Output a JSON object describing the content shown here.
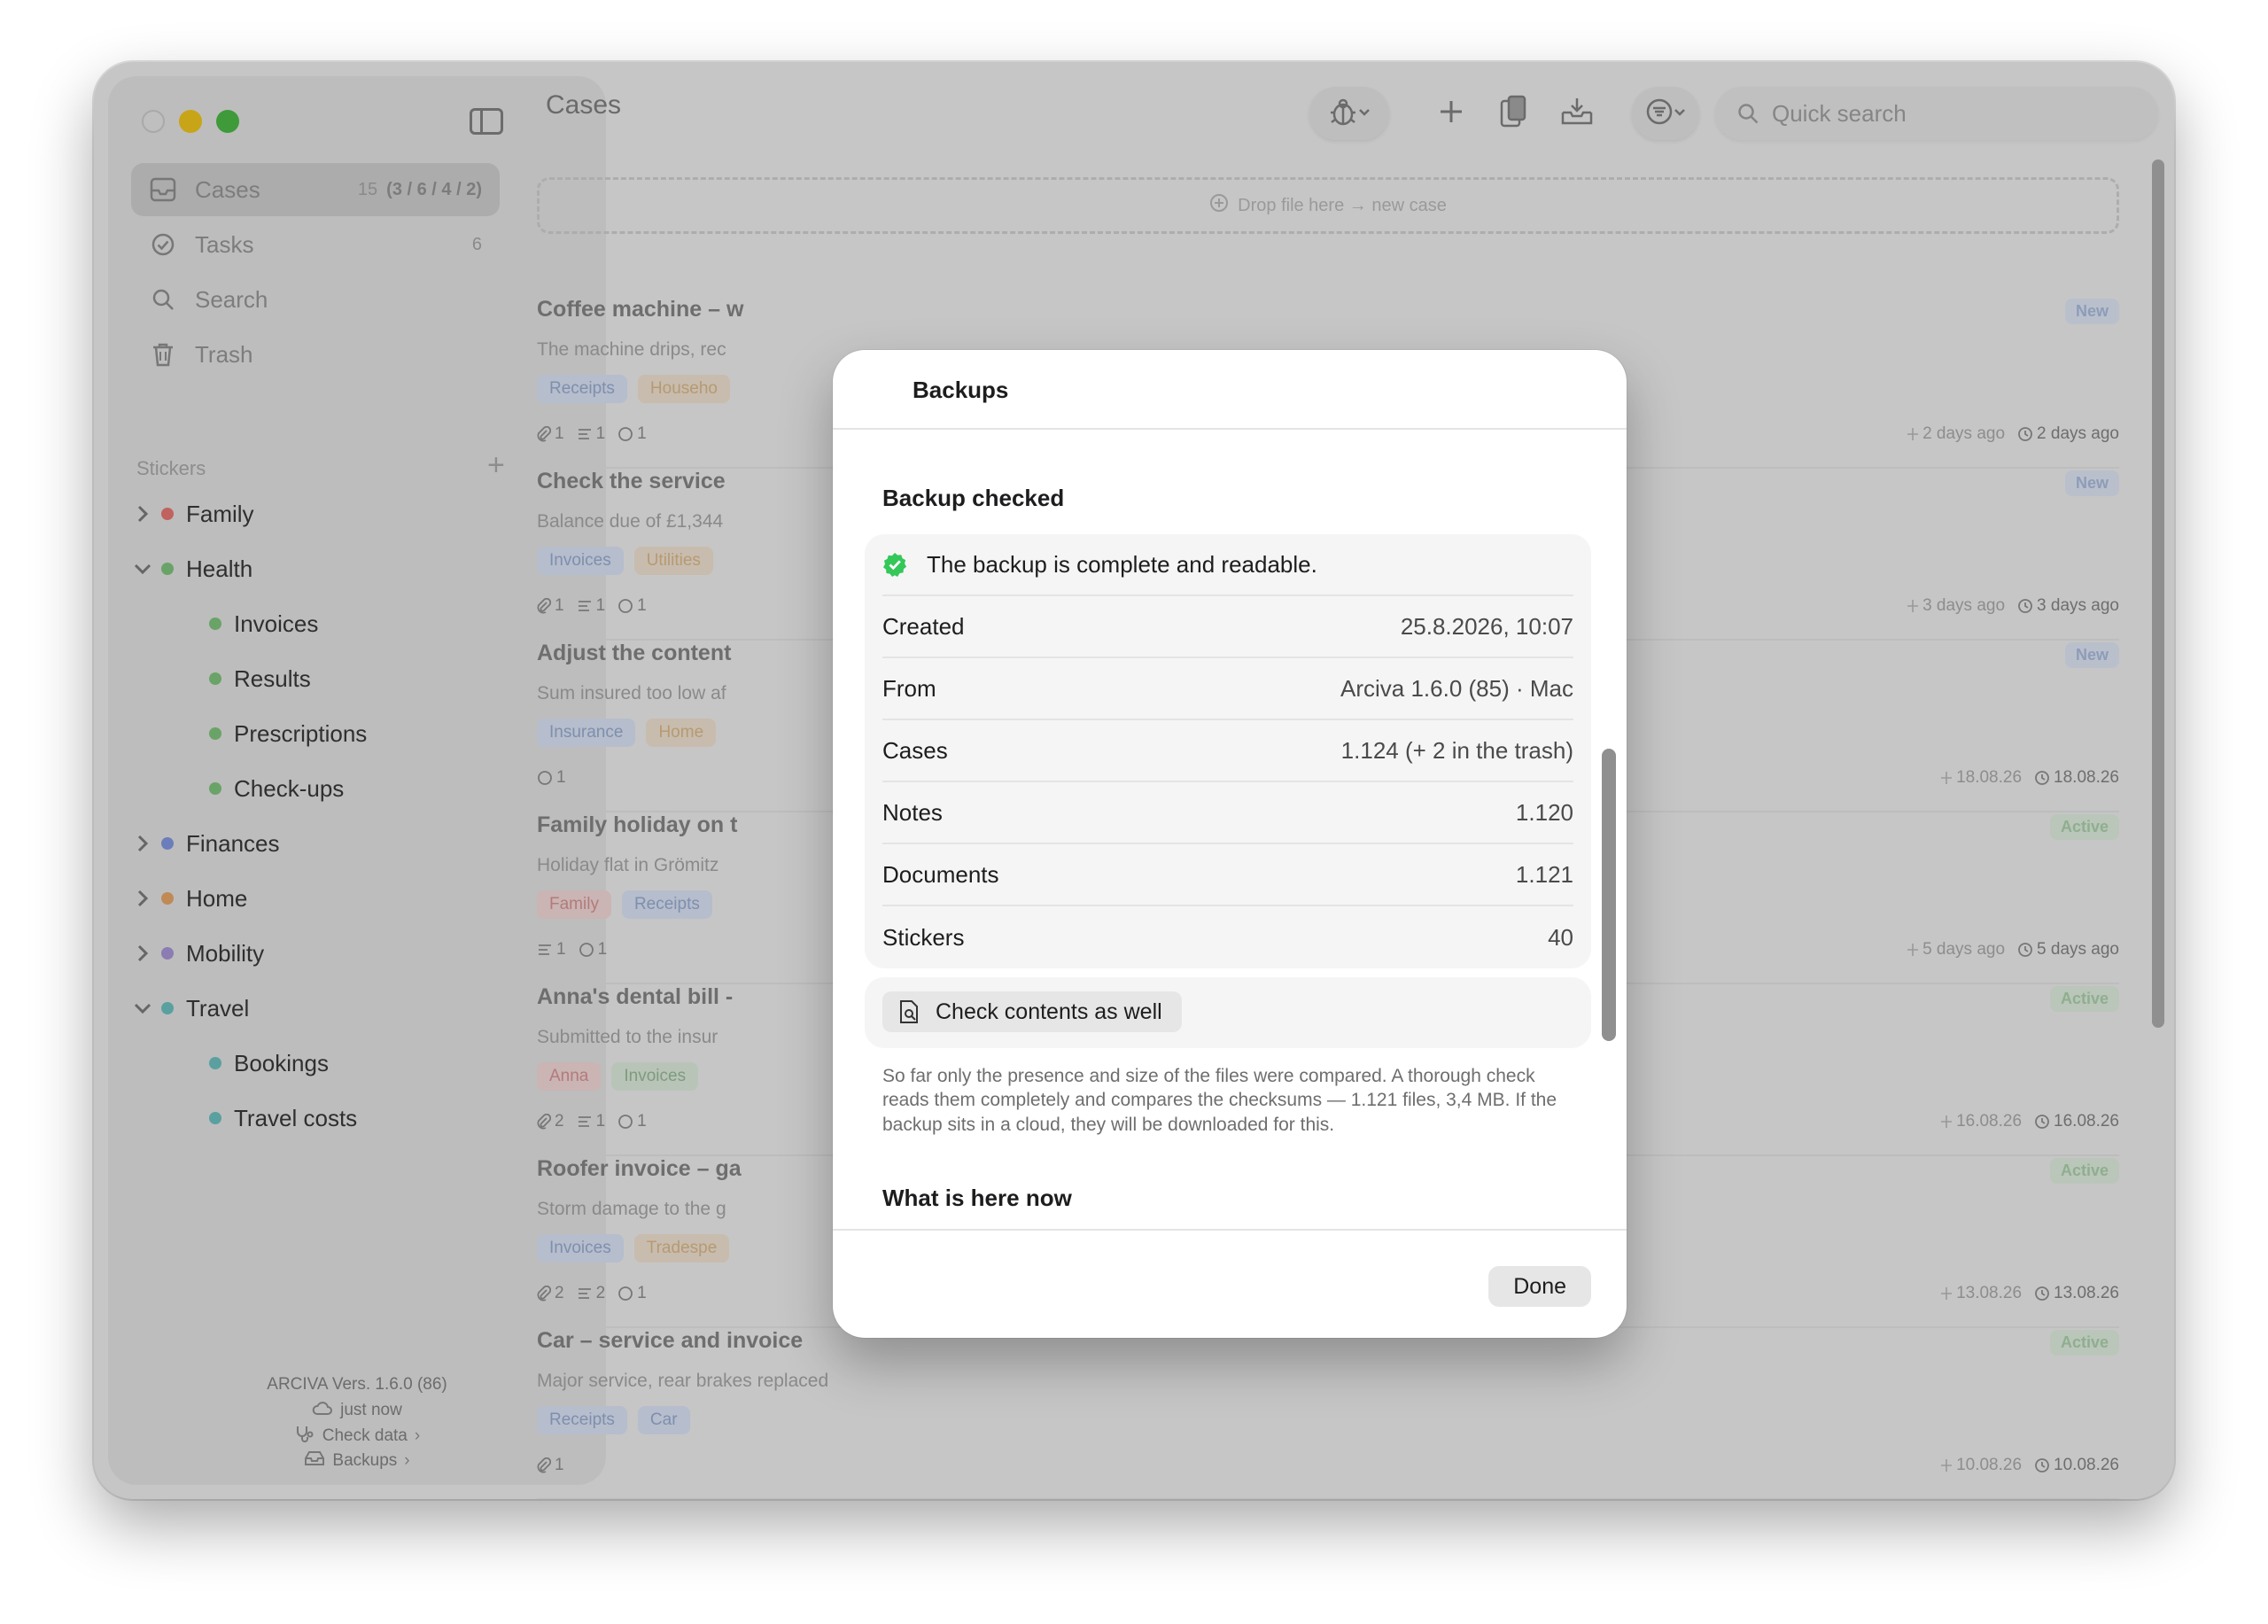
{
  "window": {
    "title": "Cases"
  },
  "sidebar": {
    "nav": [
      {
        "label": "Cases",
        "count": "15",
        "breakdown": "(3 / 6 / 4 / 2)"
      },
      {
        "label": "Tasks",
        "count": "6"
      },
      {
        "label": "Search"
      },
      {
        "label": "Trash"
      }
    ],
    "stickers_heading": "Stickers",
    "stickers_add": "+",
    "tree": [
      {
        "label": "Family",
        "color": "#c0625e",
        "expanded": false
      },
      {
        "label": "Health",
        "color": "#6aa367",
        "expanded": true
      },
      {
        "label": "Invoices",
        "color": "#6aa367"
      },
      {
        "label": "Results",
        "color": "#6aa367"
      },
      {
        "label": "Prescriptions",
        "color": "#6aa367"
      },
      {
        "label": "Check-ups",
        "color": "#6aa367"
      },
      {
        "label": "Finances",
        "color": "#6b7ebb",
        "expanded": false
      },
      {
        "label": "Home",
        "color": "#c08a55",
        "expanded": false
      },
      {
        "label": "Mobility",
        "color": "#8b7cb3",
        "expanded": false
      },
      {
        "label": "Travel",
        "color": "#5aa0a0",
        "expanded": true
      },
      {
        "label": "Bookings",
        "color": "#5aa0a0"
      },
      {
        "label": "Travel costs",
        "color": "#5aa0a0"
      }
    ],
    "footer": {
      "version": "ARCIVA  Vers. 1.6.0 (86)",
      "sync": "just now",
      "check_data": "Check data",
      "backups": "Backups"
    }
  },
  "toolbar": {
    "search_placeholder": "Quick search"
  },
  "dropzone": {
    "label": "Drop file here → new case"
  },
  "cases": [
    {
      "title": "Coffee machine – w",
      "desc": "The machine drips, rec",
      "tags": [
        [
          "Receipts",
          "blue"
        ],
        [
          "Househo",
          "orange"
        ]
      ],
      "meta": [
        "1",
        "1",
        "1"
      ],
      "status": "New",
      "status_kind": "new",
      "created": "2 days ago",
      "modified": "2 days ago"
    },
    {
      "title": "Check the service",
      "desc": "Balance due of £1,344",
      "tags": [
        [
          "Invoices",
          "blue"
        ],
        [
          "Utilities",
          "orange"
        ]
      ],
      "meta": [
        "1",
        "1",
        "1"
      ],
      "status": "New",
      "status_kind": "new",
      "created": "3 days ago",
      "modified": "3 days ago"
    },
    {
      "title": "Adjust the content",
      "desc": "Sum insured too low af",
      "tags": [
        [
          "Insurance",
          "blue"
        ],
        [
          "Home",
          "orange"
        ]
      ],
      "meta": [
        "",
        "",
        "1"
      ],
      "status": "New",
      "status_kind": "new",
      "created": "18.08.26",
      "modified": "18.08.26"
    },
    {
      "title": "Family holiday on t",
      "desc": "Holiday flat in Grömitz",
      "tags": [
        [
          "Family",
          "red"
        ],
        [
          "Receipts",
          "blue"
        ]
      ],
      "meta": [
        "",
        "1",
        "1"
      ],
      "status": "Active",
      "status_kind": "active",
      "created": "5 days ago",
      "modified": "5 days ago"
    },
    {
      "title": "Anna's dental bill -",
      "desc": "Submitted to the insur",
      "tags": [
        [
          "Anna",
          "red"
        ],
        [
          "Invoices",
          "green"
        ]
      ],
      "meta": [
        "2",
        "1",
        "1"
      ],
      "status": "Active",
      "status_kind": "active",
      "created": "16.08.26",
      "modified": "16.08.26"
    },
    {
      "title": "Roofer invoice – ga",
      "desc": "Storm damage to the g",
      "tags": [
        [
          "Invoices",
          "blue"
        ],
        [
          "Tradespe",
          "orange"
        ]
      ],
      "meta": [
        "2",
        "2",
        "1"
      ],
      "status": "Active",
      "status_kind": "active",
      "created": "13.08.26",
      "modified": "13.08.26"
    },
    {
      "title": "Car – service and invoice",
      "desc": "Major service, rear brakes replaced",
      "tags": [
        [
          "Receipts",
          "blue"
        ],
        [
          "Car",
          "blue"
        ]
      ],
      "meta": [
        "1",
        "",
        ""
      ],
      "status": "Active",
      "status_kind": "active",
      "created": "10.08.26",
      "modified": "10.08.26"
    }
  ],
  "modal": {
    "title": "Backups",
    "section1": "Backup checked",
    "ok_message": "The backup is complete and readable.",
    "rows": [
      {
        "key": "Created",
        "value": "25.8.2026, 10:07"
      },
      {
        "key": "From",
        "value": "Arciva 1.6.0 (85) · Mac"
      },
      {
        "key": "Cases",
        "value": "1.124 (+ 2 in the trash)"
      },
      {
        "key": "Notes",
        "value": "1.120"
      },
      {
        "key": "Documents",
        "value": "1.121"
      },
      {
        "key": "Stickers",
        "value": "40"
      }
    ],
    "check_button": "Check contents as well",
    "help": "So far only the presence and size of the files were compared. A thorough check reads them completely and compares the checksums — 1.121 files, 3,4 MB. If the backup sits in a cloud, they will be downloaded for this.",
    "section2": "What is here now",
    "done_button": "Done"
  }
}
